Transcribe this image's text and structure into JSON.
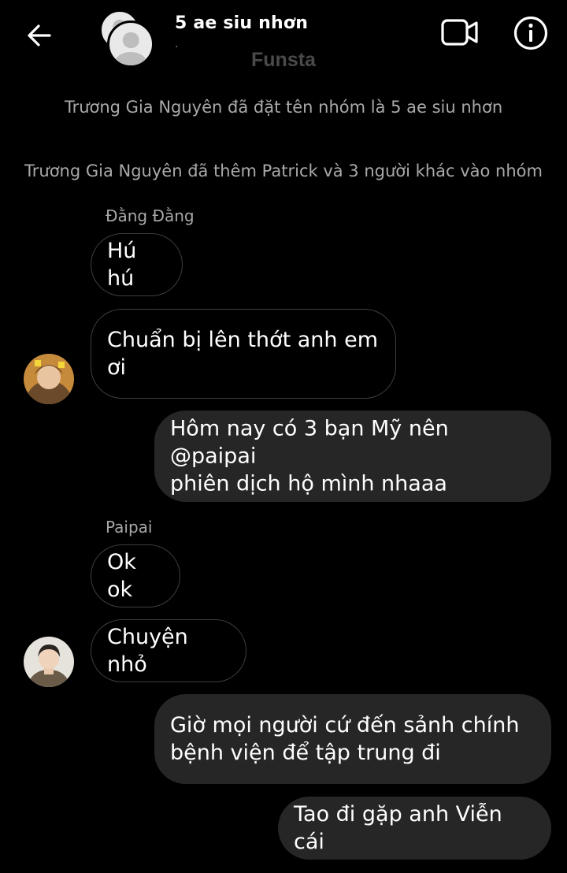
{
  "header": {
    "group_name": "5 ae siu nhơn",
    "subtitle": "·",
    "watermark": "Funsta",
    "icons": {
      "back": "back-arrow-icon",
      "video": "video-call-icon",
      "info": "info-icon"
    }
  },
  "system_messages": [
    "Trương Gia Nguyên đã đặt tên nhóm là 5 ae siu nhơn",
    "Trương Gia Nguyên đã thêm Patrick và 3 người khác vào nhóm"
  ],
  "messages": [
    {
      "sender": "Đằng Đằng",
      "text": "Hú hú",
      "direction": "incoming"
    },
    {
      "text": "Chuẩn bị lên thớt anh em ơi",
      "line1": "Chuẩn bị lên thớt anh em",
      "line2": "ơi",
      "direction": "incoming"
    },
    {
      "text": "Hôm nay có 3 bạn Mỹ nên @paipai phiên dịch hộ mình nhaaa",
      "line1": "Hôm nay có 3 bạn Mỹ nên @paipai",
      "line2": "phiên dịch hộ mình nhaaa",
      "direction": "outgoing"
    },
    {
      "sender": "Paipai",
      "text": "Ok ok",
      "direction": "incoming"
    },
    {
      "text": "Chuyện nhỏ",
      "direction": "incoming"
    },
    {
      "text": "Giờ mọi người cứ đến sảnh chính bệnh viện để tập trung đi",
      "line1": "Giờ mọi người cứ đến sảnh chính",
      "line2": "bệnh viện để tập trung đi",
      "direction": "outgoing"
    },
    {
      "text": "Tao đi gặp anh Viễn cái",
      "direction": "outgoing"
    }
  ],
  "colors": {
    "background": "#000000",
    "outgoing_bubble": "#262626",
    "incoming_border": "#3e3e3e",
    "system_text": "#a9a9a9"
  }
}
